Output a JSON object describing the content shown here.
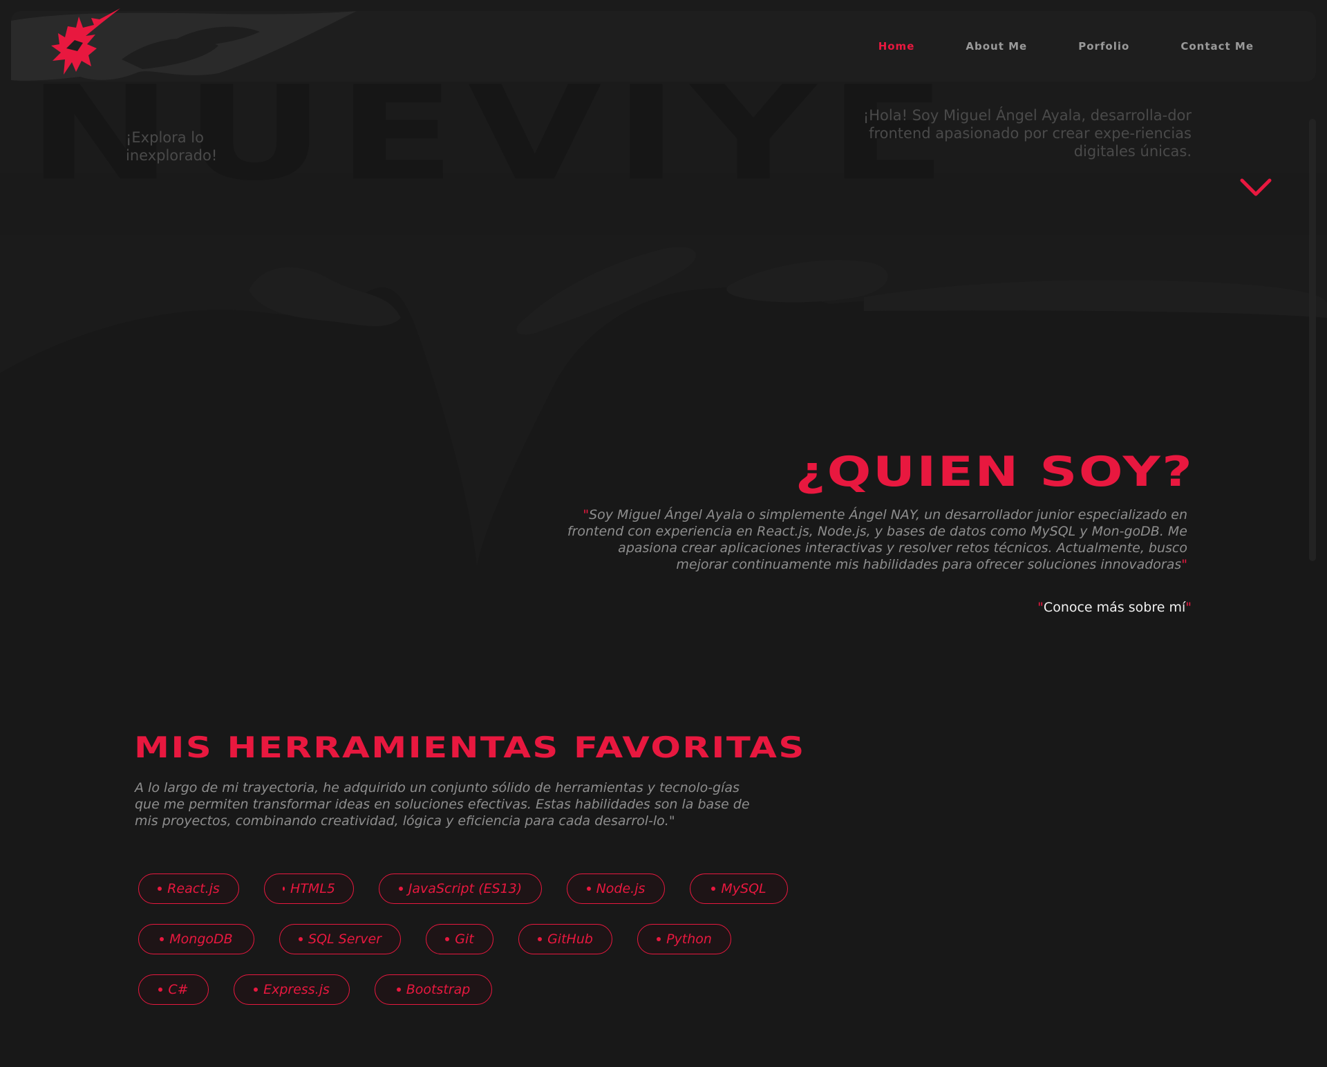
{
  "nav": {
    "logo": "logo-icon",
    "links": [
      {
        "label": "Home",
        "active": true
      },
      {
        "label": "About Me",
        "active": false
      },
      {
        "label": "Porfolio",
        "active": false
      },
      {
        "label": "Contact Me",
        "active": false
      }
    ]
  },
  "hero": {
    "tagline": "¡Explora lo inexplorado!",
    "intro": "¡Hola! Soy Miguel Ángel Ayala, desarrolla-dor frontend apasionado por crear expe-riencias digitales únicas.",
    "scroll_icon": "chevron-down-icon"
  },
  "about": {
    "title": "¿QUIEN SOY?",
    "open_quote": "\"",
    "text": "Soy Miguel Ángel Ayala o simplemente Ángel NAY, un desarrollador junior especializado en frontend con experiencia en React.js, Node.js, y bases de datos como MySQL y Mon-goDB. Me apasiona crear aplicaciones interactivas y resolver retos técnicos. Actualmente, busco mejorar continuamente mis habilidades para ofrecer soluciones innovadoras",
    "close_quote": "\"",
    "link_open_quote": "\"",
    "link_label": "Conoce más sobre mí",
    "link_close_quote": "\""
  },
  "tools": {
    "title": "MIS HERRAMIENTAS FAVORITAS",
    "text": "A lo largo de mi trayectoria, he adquirido un conjunto sólido de herramientas y tecnolo-gías que me permiten transformar ideas en soluciones efectivas. Estas habilidades son la base de mis proyectos, combinando creatividad, lógica y eficiencia para cada desarrol-lo.\"",
    "rows": [
      [
        "React.js",
        "HTML5",
        "JavaScript (ES13)",
        "Node.js",
        "MySQL"
      ],
      [
        "MongoDB",
        "SQL Server",
        "Git",
        "GitHub",
        "Python"
      ],
      [
        "C#",
        "Express.js",
        "Bootstrap"
      ]
    ]
  },
  "colors": {
    "accent": "#e8183f",
    "background": "#181818",
    "nav_background": "#1e1e1e",
    "muted_text": "#8e8e8e"
  }
}
